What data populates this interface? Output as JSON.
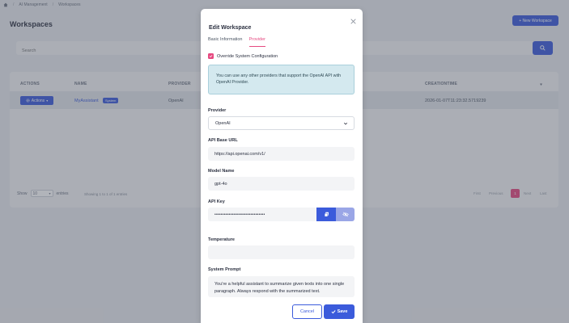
{
  "breadcrumb": {
    "items": [
      "AI Management",
      "Workspaces"
    ]
  },
  "page": {
    "title": "Workspaces",
    "new_button": "+ New Workspace"
  },
  "search": {
    "placeholder": "Search"
  },
  "table": {
    "headers": [
      "ACTIONS",
      "NAME",
      "PROVIDER",
      "CREATIONTIME"
    ],
    "row": {
      "actions": "Actions",
      "name": "MyAssistant",
      "badge": "System",
      "provider": "OpenAI",
      "creation_time": "2026-01-07T11:23:32.5719239"
    },
    "show_label": "Show",
    "page_size": "10",
    "entries_label": "entries",
    "showing": "Showing 1 to 1 of 1 entries",
    "pager": [
      "First",
      "Previous",
      "1",
      "Next",
      "Last"
    ]
  },
  "modal": {
    "title": "Edit Workspace",
    "tabs": [
      {
        "label": "Basic Information"
      },
      {
        "label": "Provider"
      }
    ],
    "override_label": "Override System Configuration",
    "info_text": "You can use any other providers that support the OpenAI API with OpenAI Provider.",
    "provider_label": "Provider",
    "provider_value": "OpenAI",
    "api_base_label": "API Base URL",
    "api_base_value": "https://api.openai.com/v1/",
    "model_label": "Model Name",
    "model_value": "gpt-4o",
    "api_key_label": "API Key",
    "api_key_value": "••••••••••••••••••••••••••••••••",
    "temperature_label": "Temperature",
    "temperature_value": "",
    "system_prompt_label": "System Prompt",
    "system_prompt_value": "You're a helpful assistant to summarize given texts into one single paragraph. Always respond with the summarized text.",
    "cancel_label": "Cancel",
    "save_label": "Save"
  },
  "colors": {
    "primary": "#3b5bdb",
    "accent": "#e64980",
    "info_bg": "#d4e9ef"
  }
}
